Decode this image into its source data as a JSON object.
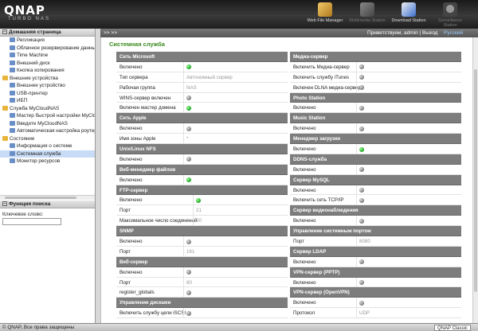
{
  "header": {
    "logo": "QNAP",
    "logo_sub": "TURBO NAS",
    "apps": [
      {
        "label": "Web File Manager",
        "icon": "folder-icon",
        "active": true
      },
      {
        "label": "Multimedia Station",
        "icon": "multimedia-icon",
        "active": false
      },
      {
        "label": "Download Station",
        "icon": "download-icon",
        "active": true
      },
      {
        "label": "Surveillance Station",
        "icon": "camera-icon",
        "active": false
      }
    ]
  },
  "left_panel": {
    "title": "Домашняя страница",
    "tree": [
      {
        "label": "Репликация",
        "level": 1,
        "icon": "replication-icon"
      },
      {
        "label": "Облачное резервирование данных",
        "level": 1,
        "icon": "cloud-backup-icon"
      },
      {
        "label": "Time Machine",
        "level": 1,
        "icon": "time-machine-icon"
      },
      {
        "label": "Внешний диск",
        "level": 1,
        "icon": "external-disk-icon"
      },
      {
        "label": "Кнопка копирования",
        "level": 1,
        "icon": "copy-button-icon"
      },
      {
        "label": "Внешние устройства",
        "level": 0,
        "icon": "folder-icon"
      },
      {
        "label": "Внешнее устройство",
        "level": 1,
        "icon": "device-icon"
      },
      {
        "label": "USB-принтер",
        "level": 1,
        "icon": "printer-icon"
      },
      {
        "label": "ИБП",
        "level": 1,
        "icon": "ups-icon"
      },
      {
        "label": "Служба MyCloudNAS",
        "level": 0,
        "icon": "folder-icon"
      },
      {
        "label": "Мастер быстрой настройки MyClou",
        "level": 1,
        "icon": "wizard-icon"
      },
      {
        "label": "Введите MyCloudNAS",
        "level": 1,
        "icon": "cloud-icon"
      },
      {
        "label": "Автоматическая настройка роутера",
        "level": 1,
        "icon": "router-icon"
      },
      {
        "label": "Состояние",
        "level": 0,
        "icon": "folder-icon"
      },
      {
        "label": "Информация о системе",
        "level": 1,
        "icon": "info-icon"
      },
      {
        "label": "Системная служба",
        "level": 1,
        "icon": "system-service-icon",
        "selected": true
      },
      {
        "label": "Монитор ресурсов",
        "level": 1,
        "icon": "monitor-icon"
      }
    ],
    "search_title": "Функция поиска",
    "search_label": "Ключевое слово:",
    "search_value": ""
  },
  "topbar": {
    "arrows": ">> >>",
    "greeting": "Приветствуем, admin | Выход",
    "language": "Русский"
  },
  "main": {
    "title": "Системная служба",
    "left_rows": [
      {
        "type": "hd",
        "k": "Сеть Microsoft"
      },
      {
        "k": "Включено",
        "dot": "on"
      },
      {
        "k": "Тип сервера",
        "v": "Автономный сервер"
      },
      {
        "k": "Рабочая группа",
        "v": "NAS"
      },
      {
        "k": "WINS-сервер включен",
        "dot": "off"
      },
      {
        "k": "Включен мастер домена",
        "dot": "on"
      },
      {
        "type": "hd",
        "k": "Сеть Apple"
      },
      {
        "k": "Включено",
        "dot": "off"
      },
      {
        "k": "Имя зоны Apple",
        "v": "*"
      },
      {
        "type": "hd",
        "k": "Unix/Linux NFS"
      },
      {
        "k": "Включено",
        "dot": "off"
      },
      {
        "type": "hd",
        "k": "Веб-менеджер файлов"
      },
      {
        "k": "Включено",
        "dot": "on"
      },
      {
        "type": "hd",
        "k": "FTP-сервер"
      },
      {
        "k": "Включено",
        "dot": "on",
        "wide": true
      },
      {
        "k": "Порт",
        "v": "21",
        "wide": true
      },
      {
        "k": "Максимальное число соединений",
        "v": "30",
        "wide": true
      },
      {
        "type": "hd",
        "k": "SNMP"
      },
      {
        "k": "Включено",
        "dot": "off"
      },
      {
        "k": "Порт",
        "v": "161"
      },
      {
        "type": "hd",
        "k": "Веб-сервер"
      },
      {
        "k": "Включено",
        "dot": "off"
      },
      {
        "k": "Порт",
        "v": "80"
      },
      {
        "k": "register_globals",
        "dot": "off"
      },
      {
        "type": "hd",
        "k": "Управление дисками"
      },
      {
        "k": "Включить службу цели iSCSI",
        "dot": "off"
      }
    ],
    "right_rows": [
      {
        "type": "hd",
        "k": "Медиа-сервер"
      },
      {
        "k": "Включить Медиа-сервер",
        "dot": "off"
      },
      {
        "k": "Включить службу iTunes",
        "dot": "off"
      },
      {
        "k": "Включен DLNA медиа-сервер",
        "dot": "off"
      },
      {
        "type": "hd",
        "k": "Photo Station"
      },
      {
        "k": "Включено",
        "dot": "off"
      },
      {
        "type": "hd",
        "k": "Music Station"
      },
      {
        "k": "Включено",
        "dot": "off"
      },
      {
        "type": "hd",
        "k": "Менеджер загрузки"
      },
      {
        "k": "Включено",
        "dot": "on"
      },
      {
        "type": "hd",
        "k": "DDNS-служба"
      },
      {
        "k": "Включено",
        "dot": "off"
      },
      {
        "type": "hd",
        "k": "Сервер MySQL"
      },
      {
        "k": "Включено",
        "dot": "off"
      },
      {
        "k": "Включить сеть TCP/IP",
        "dot": "off"
      },
      {
        "type": "hd",
        "k": "Сервер видеонаблюдения"
      },
      {
        "k": "Включено",
        "dot": "off"
      },
      {
        "type": "hd",
        "k": "Управление системным портом"
      },
      {
        "k": "Порт",
        "v": "8080"
      },
      {
        "type": "hd",
        "k": "Сервер LDAP"
      },
      {
        "k": "Включено",
        "dot": "off"
      },
      {
        "type": "hd",
        "k": "VPN-сервер (PPTP)"
      },
      {
        "k": "Включено",
        "dot": "off"
      },
      {
        "type": "hd",
        "k": "VPN-сервер (OpenVPN)"
      },
      {
        "k": "Включено",
        "dot": "off"
      },
      {
        "k": "Протокол",
        "v": "UDP"
      }
    ]
  },
  "footer": {
    "copyright": "© QNAP, Все права защищены",
    "theme": "QNAP Classic"
  },
  "colors": {
    "title_green": "#3a8a1e",
    "header_row": "#7d7d7d",
    "status_on": "#1a9e1a",
    "status_off": "#777777"
  }
}
